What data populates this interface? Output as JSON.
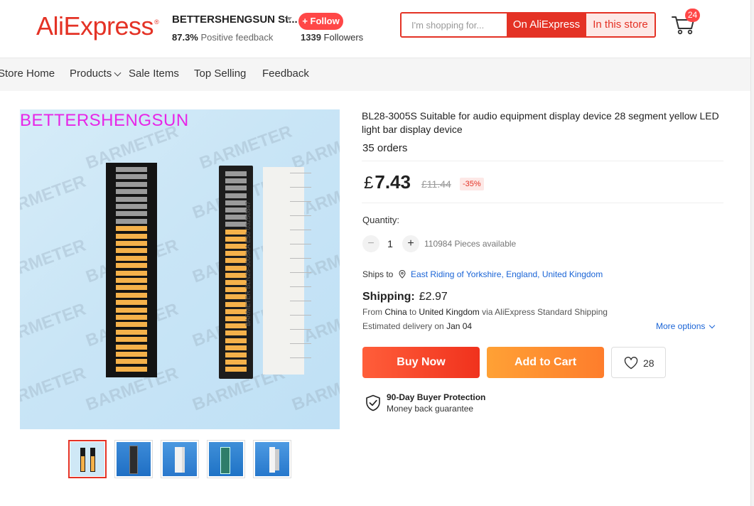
{
  "header": {
    "logo_text": "AliExpress",
    "logo_mark": "®",
    "store_name": "BETTERSHENGSUN St...",
    "feedback_pct": "87.3%",
    "feedback_label": "Positive feedback",
    "follow_label": "+ Follow",
    "followers_count": "1339",
    "followers_label": "Followers",
    "search_placeholder": "I'm shopping for...",
    "search_ali_label": "On AliExpress",
    "search_store_label": "In this store",
    "cart_count": "24"
  },
  "nav": {
    "items": [
      "Store Home",
      "Products",
      "Sale Items",
      "Top Selling",
      "Feedback"
    ]
  },
  "gallery": {
    "brand_label": "BETTERSHENGSUN",
    "watermark": "BARMETER",
    "device_print": "BARMETER BLN28-3005KA E50 03250847",
    "thumb_count": 5,
    "active_thumb": 1
  },
  "product": {
    "title": "BL28-3005S Suitable for audio equipment display device 28 segment yellow LED light bar display device",
    "orders": "35 orders",
    "currency": "£",
    "price": "7.43",
    "old_price": "£11.44",
    "discount": "-35%",
    "quantity_label": "Quantity:",
    "quantity_value": "1",
    "minus_symbol": "−",
    "plus_symbol": "+",
    "available": "110984 Pieces available",
    "ships_to_label": "Ships to",
    "ships_to_location": "East Riding of Yorkshire, England, United Kingdom",
    "shipping_label": "Shipping:",
    "shipping_price": "£2.97",
    "from_label": "From",
    "from_country": "China",
    "to_label": "to",
    "to_country": "United Kingdom",
    "via_text": "via AliExpress Standard Shipping",
    "eta_label": "Estimated delivery on",
    "eta_date": "Jan 04",
    "more_options": "More options",
    "buy_now": "Buy Now",
    "add_to_cart": "Add to Cart",
    "wishlist_count": "28",
    "protection_title": "90-Day Buyer Protection",
    "protection_sub": "Money back guarantee"
  },
  "colors": {
    "brand_red": "#e43225",
    "buy_now": "#f0321d",
    "add_to_cart": "#fe7d2c",
    "link_blue": "#1a64d6",
    "led_lit": "#f5b14a",
    "led_unlit": "#9a9a9a"
  }
}
